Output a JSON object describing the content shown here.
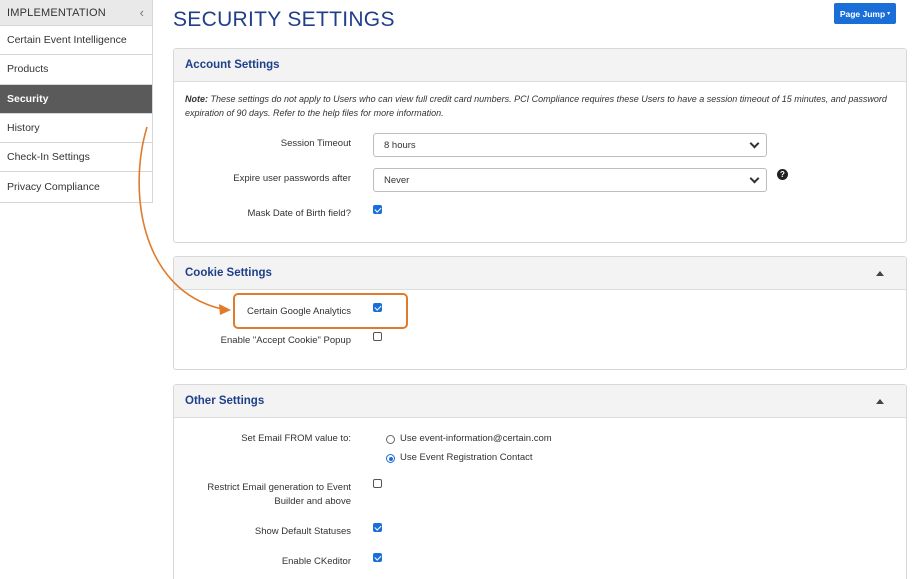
{
  "sidebar": {
    "header": "IMPLEMENTATION",
    "collapse_icon": "‹",
    "items": [
      {
        "label": "Certain Event Intelligence",
        "active": false
      },
      {
        "label": "Products",
        "active": false
      },
      {
        "label": "Security",
        "active": true
      },
      {
        "label": "History",
        "active": false
      },
      {
        "label": "Check-In Settings",
        "active": false
      },
      {
        "label": "Privacy Compliance",
        "active": false
      }
    ]
  },
  "page": {
    "title": "SECURITY SETTINGS",
    "page_jump": "Page Jump"
  },
  "account": {
    "title": "Account Settings",
    "note_prefix": "Note:",
    "note_text": " These settings do not apply to Users who can view full credit card numbers. PCI Compliance requires these Users to have a session timeout of 15 minutes, and password expiration of 90 days. Refer to the help files for more information.",
    "session_timeout_label": "Session Timeout",
    "session_timeout_value": "8 hours",
    "expire_label": "Expire user passwords after",
    "expire_value": "Never",
    "help_glyph": "?",
    "mask_dob_label": "Mask Date of Birth field?",
    "mask_dob_checked": true
  },
  "cookie": {
    "title": "Cookie Settings",
    "google_analytics_label": "Certain Google Analytics",
    "google_analytics_checked": true,
    "accept_cookie_label": "Enable \"Accept Cookie\" Popup",
    "accept_cookie_checked": false
  },
  "other": {
    "title": "Other Settings",
    "email_from_label": "Set Email FROM value to:",
    "email_option_1": "Use event-information@certain.com",
    "email_option_2": "Use Event Registration Contact",
    "email_selected": 2,
    "restrict_label_line1": "Restrict Email generation to Event",
    "restrict_label_line2": "Builder and above",
    "restrict_checked": false,
    "default_statuses_label": "Show Default Statuses",
    "default_statuses_checked": true,
    "ckeditor_label": "Enable CKeditor",
    "ckeditor_checked": true
  },
  "colors": {
    "accent_blue": "#1a6ed8",
    "title_blue": "#1f3f8a",
    "annotation_orange": "#e07b2c",
    "sidebar_active": "#5a5a5a"
  }
}
